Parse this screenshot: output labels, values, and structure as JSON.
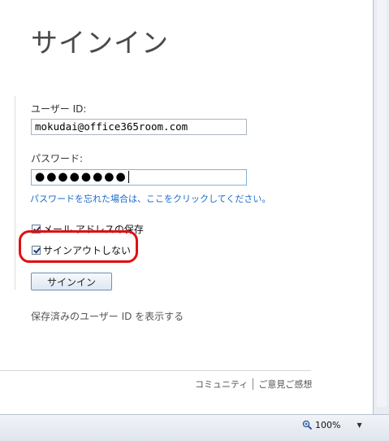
{
  "page": {
    "title": "サインイン"
  },
  "form": {
    "user_id_label": "ユーザー ID:",
    "user_id_value": "mokudai@office365room.com",
    "password_label": "パスワード:",
    "password_mask": "●●●●●●●●",
    "forgot_link": "パスワードを忘れた場合は、ここをクリックしてください。",
    "remember_email_label": "メール アドレスの保存",
    "stay_signed_in_label": "サインアウトしない",
    "signin_button": "サインイン",
    "show_saved_link": "保存済みのユーザー ID を表示する"
  },
  "footer": {
    "community_link": "コミュニティ",
    "feedback_link": "ご意見ご感想"
  },
  "status_bar": {
    "zoom": "100%"
  },
  "colors": {
    "highlight": "#e01010",
    "link": "#1b6ac9"
  }
}
